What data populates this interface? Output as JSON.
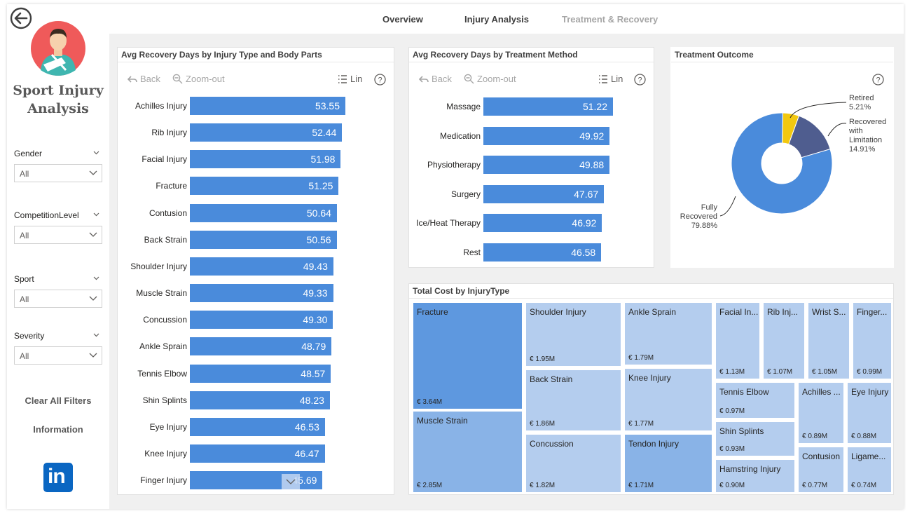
{
  "sidebar": {
    "title_line1": "Sport Injury",
    "title_line2": "Analysis",
    "filters": [
      {
        "label": "Gender",
        "value": "All"
      },
      {
        "label": "CompetitionLevel",
        "value": "All"
      },
      {
        "label": "Sport",
        "value": "All"
      },
      {
        "label": "Severity",
        "value": "All"
      }
    ],
    "clear_filters": "Clear All Filters",
    "information": "Information",
    "linkedin": "in"
  },
  "nav": {
    "tabs": [
      "Overview",
      "Injury Analysis",
      "Treatment & Recovery"
    ],
    "active": "Injury Analysis",
    "disabled": "Treatment & Recovery"
  },
  "toolbar": {
    "back": "Back",
    "zoom_out": "Zoom-out",
    "lin": "Lin",
    "help": "?"
  },
  "chart_injury": {
    "title": "Avg Recovery Days by Injury Type and Body Parts"
  },
  "chart_treatment": {
    "title": "Avg Recovery Days by Treatment Method"
  },
  "chart_outcome": {
    "title": "Treatment Outcome",
    "labels": {
      "retired": [
        "Retired",
        "5.21%"
      ],
      "limitation": [
        "Recovered",
        "with",
        "Limitation",
        "14.91%"
      ],
      "fully": [
        "Fully",
        "Recovered",
        "79.88%"
      ]
    }
  },
  "chart_cost": {
    "title": "Total Cost by InjuryType"
  },
  "chart_data": [
    {
      "type": "bar",
      "orientation": "horizontal",
      "title": "Avg Recovery Days by Injury Type and Body Parts",
      "categories": [
        "Achilles Injury",
        "Rib Injury",
        "Facial Injury",
        "Fracture",
        "Contusion",
        "Back Strain",
        "Shoulder Injury",
        "Muscle Strain",
        "Concussion",
        "Ankle Sprain",
        "Tennis Elbow",
        "Shin Splints",
        "Eye Injury",
        "Knee Injury",
        "Finger Injury"
      ],
      "values": [
        53.55,
        52.44,
        51.98,
        51.25,
        50.64,
        50.56,
        49.43,
        49.33,
        49.3,
        48.79,
        48.57,
        48.23,
        46.53,
        46.47,
        45.69
      ],
      "labels": [
        "53.55",
        "52.44",
        "51.98",
        "51.25",
        "50.64",
        "50.56",
        "49.43",
        "49.33",
        "49.30",
        "48.79",
        "48.57",
        "48.23",
        "46.53",
        "46.47",
        "45.69"
      ],
      "color": "#4a8bdb",
      "grid": false
    },
    {
      "type": "bar",
      "orientation": "horizontal",
      "title": "Avg Recovery Days by Treatment Method",
      "categories": [
        "Massage",
        "Medication",
        "Physiotherapy",
        "Surgery",
        "Ice/Heat Therapy",
        "Rest"
      ],
      "values": [
        51.22,
        49.92,
        49.88,
        47.67,
        46.92,
        46.58
      ],
      "labels": [
        "51.22",
        "49.92",
        "49.88",
        "47.67",
        "46.92",
        "46.58"
      ],
      "color": "#4a8bdb",
      "grid": false
    },
    {
      "type": "pie",
      "variant": "donut",
      "title": "Treatment Outcome",
      "categories": [
        "Retired",
        "Recovered with Limitation",
        "Fully Recovered"
      ],
      "values": [
        5.21,
        14.91,
        79.88
      ],
      "colors": [
        "#f2c80f",
        "#4f5d8f",
        "#4a8bdb"
      ]
    },
    {
      "type": "treemap",
      "title": "Total Cost by InjuryType",
      "categories": [
        "Fracture",
        "Muscle Strain",
        "Shoulder Injury",
        "Back Strain",
        "Concussion",
        "Ankle Sprain",
        "Knee Injury",
        "Tendon Injury",
        "Facial In...",
        "Rib Inj...",
        "Wrist S...",
        "Finger...",
        "Tennis Elbow",
        "Shin Splints",
        "Hamstring Injury",
        "Achilles ...",
        "Eye Injury",
        "Contusion",
        "Ligame..."
      ],
      "values": [
        3.64,
        2.85,
        1.95,
        1.86,
        1.82,
        1.79,
        1.77,
        1.71,
        1.13,
        1.07,
        1.05,
        0.99,
        0.97,
        0.93,
        0.9,
        0.89,
        0.88,
        0.77,
        0.74
      ],
      "labels": [
        "€ 3.64M",
        "€ 2.85M",
        "€ 1.95M",
        "€ 1.86M",
        "€ 1.82M",
        "€ 1.79M",
        "€ 1.77M",
        "€ 1.71M",
        "€ 1.13M",
        "€ 1.07M",
        "€ 1.05M",
        "€ 0.99M",
        "€ 0.97M",
        "€ 0.93M",
        "€ 0.90M",
        "€ 0.89M",
        "€ 0.88M",
        "€ 0.77M",
        "€ 0.74M"
      ],
      "unit": "€ M"
    }
  ]
}
